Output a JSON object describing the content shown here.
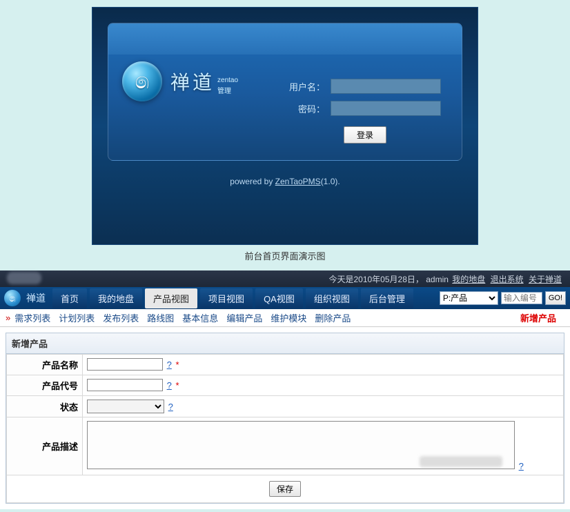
{
  "login": {
    "brand_main": "禅道",
    "brand_en": "zentao",
    "brand_sub": "管理",
    "username_label": "用户名：",
    "password_label": "密码：",
    "login_btn": "登录",
    "powered_prefix": "powered by ",
    "powered_link": "ZenTaoPMS",
    "powered_suffix": "(1.0).",
    "caption": "前台首页界面演示图"
  },
  "topbar": {
    "date_text": "今天是2010年05月28日，",
    "user": "admin",
    "link_dashboard": "我的地盘",
    "link_logout": "退出系统",
    "link_about": "关于禅道"
  },
  "nav": {
    "brand": "禅道",
    "items": [
      {
        "label": "首页",
        "active": false
      },
      {
        "label": "我的地盘",
        "active": false
      },
      {
        "label": "产品视图",
        "active": true
      },
      {
        "label": "项目视图",
        "active": false
      },
      {
        "label": "QA视图",
        "active": false
      },
      {
        "label": "组织视图",
        "active": false
      },
      {
        "label": "后台管理",
        "active": false
      }
    ],
    "select_value": "P:产品",
    "search_placeholder": "输入编号",
    "go": "GO!"
  },
  "subnav": {
    "items": [
      "需求列表",
      "计划列表",
      "发布列表",
      "路线图",
      "基本信息",
      "编辑产品",
      "维护模块",
      "删除产品"
    ],
    "action": "新增产品"
  },
  "form": {
    "title": "新增产品",
    "name_label": "产品名称",
    "code_label": "产品代号",
    "status_label": "状态",
    "desc_label": "产品描述",
    "help": "?",
    "required": "*",
    "save": "保存"
  }
}
